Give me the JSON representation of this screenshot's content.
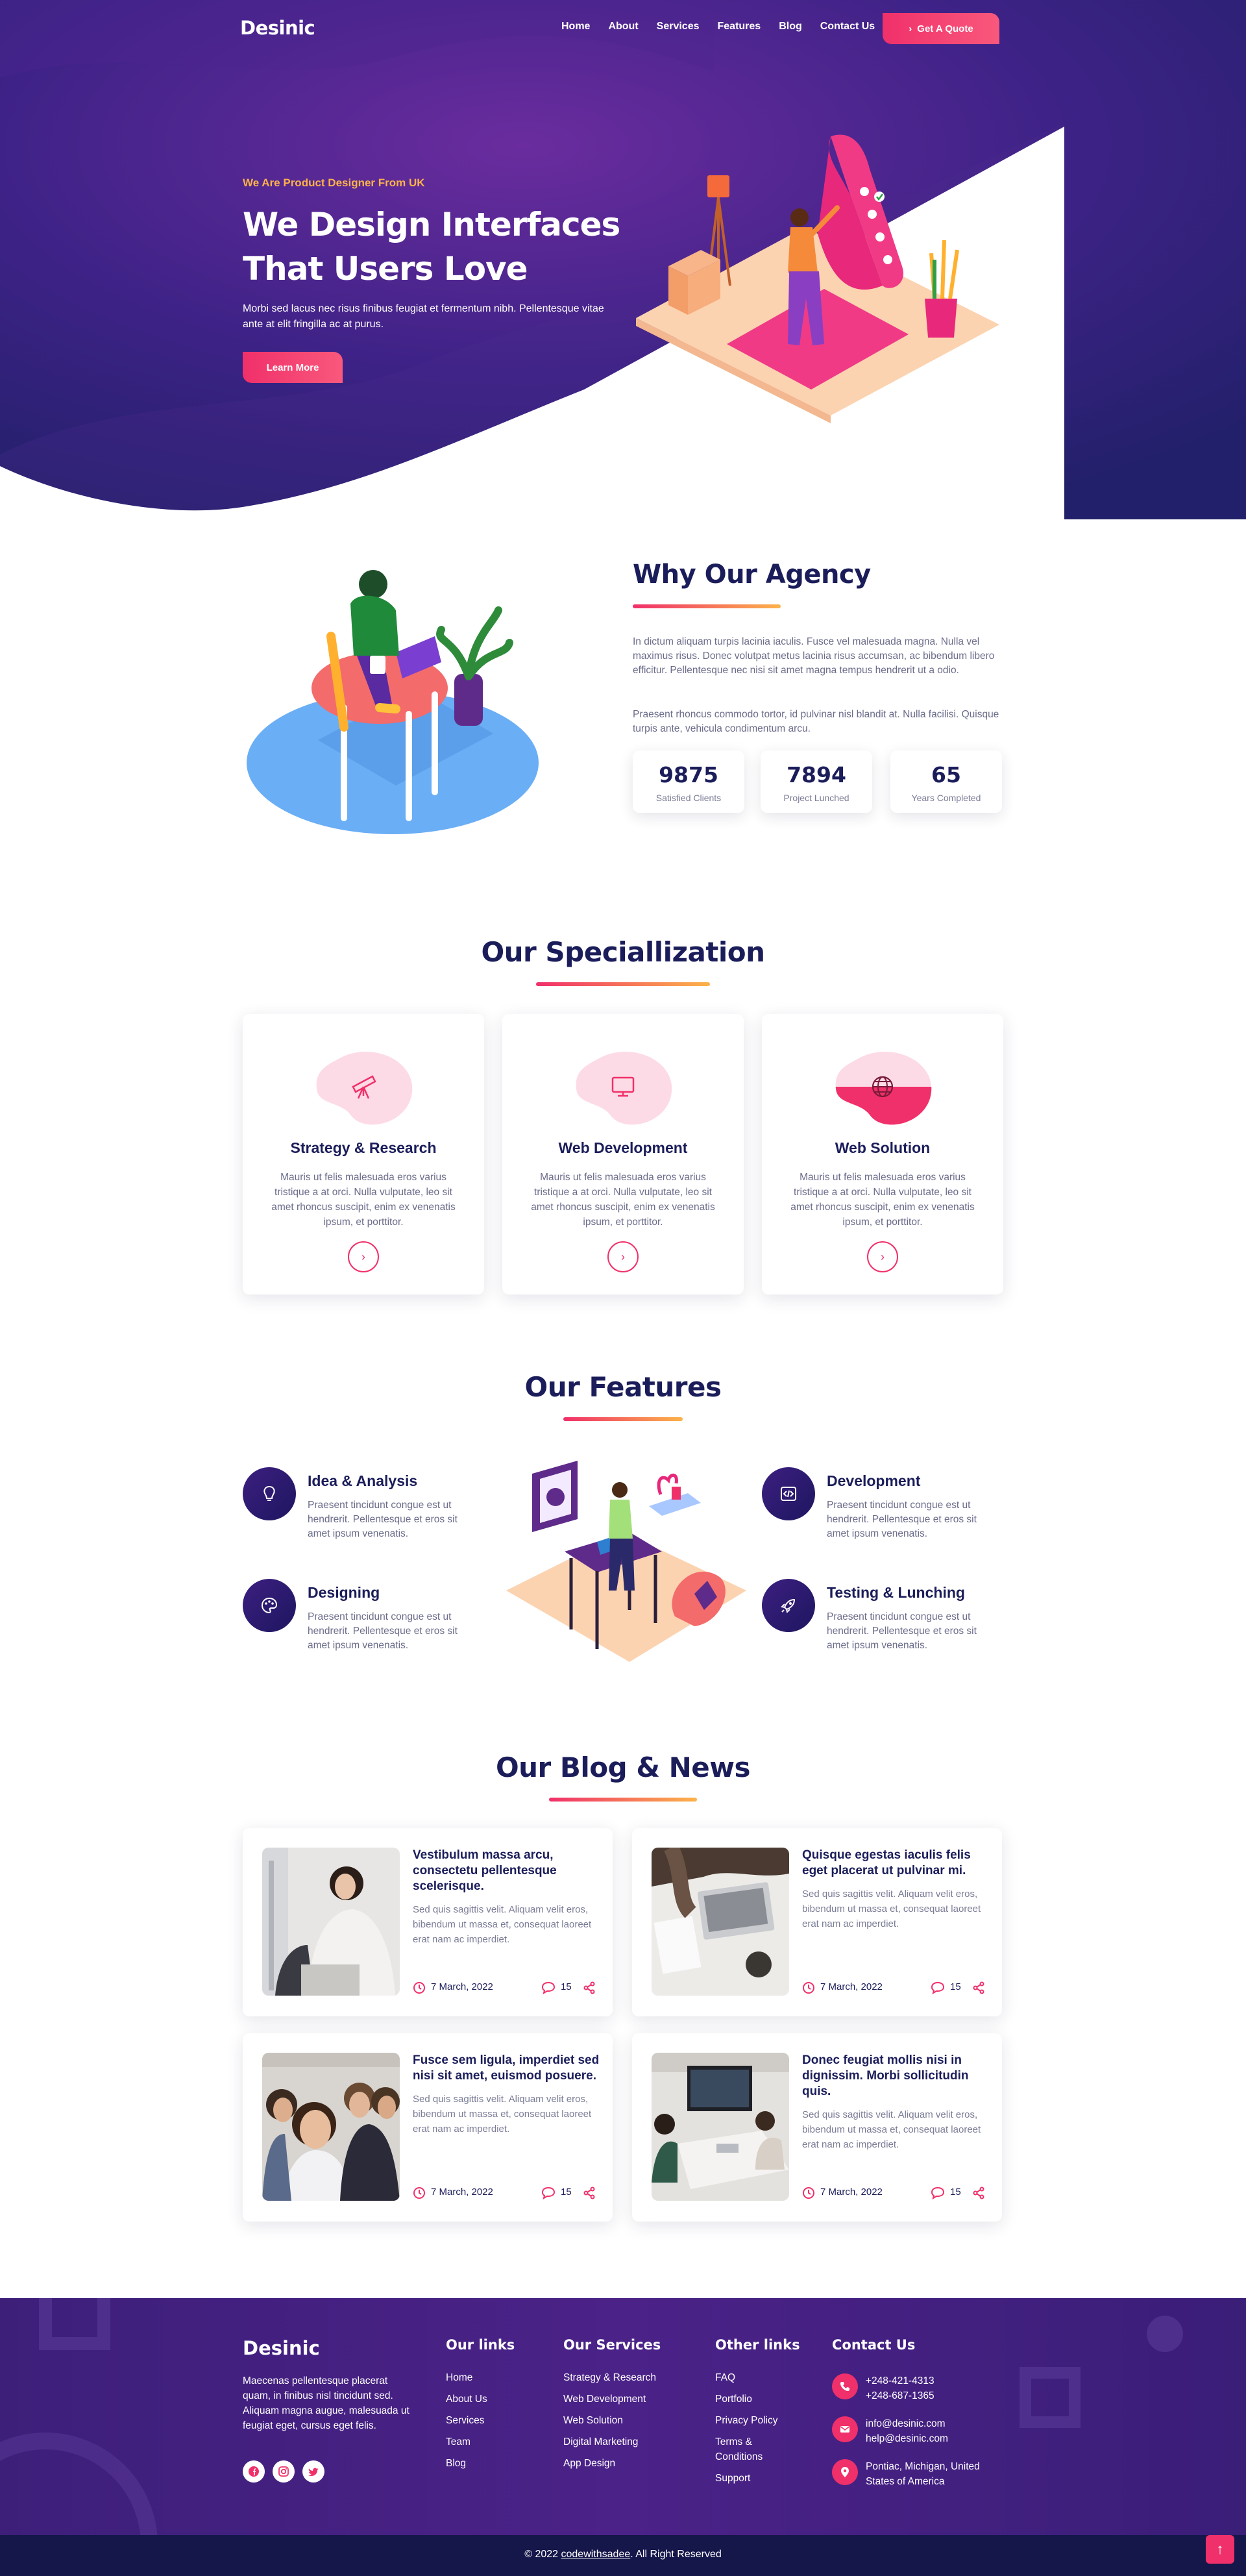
{
  "nav": {
    "brand": "Desinic",
    "links": [
      "Home",
      "About",
      "Services",
      "Features",
      "Blog",
      "Contact Us"
    ],
    "cta": "Get A Quote",
    "cta_icon": "chevron-right-icon"
  },
  "hero": {
    "eyebrow": "We Are Product Designer From UK",
    "title_line1": "We Design Interfaces",
    "title_line2": "That Users Love",
    "subtitle": "Morbi sed lacus nec risus finibus feugiat et fermentum nibh. Pellentesque vitae ante at elit fringilla ac at purus.",
    "button": "Learn More"
  },
  "agency": {
    "title": "Why Our Agency",
    "p1": "In dictum aliquam turpis lacinia iaculis. Fusce vel malesuada magna. Nulla vel maximus risus. Donec volutpat metus lacinia risus accumsan, ac bibendum libero efficitur. Pellentesque nec nisi sit amet magna tempus hendrerit ut a odio.",
    "p2": "Praesent rhoncus commodo tortor, id pulvinar nisl blandit at. Nulla facilisi. Quisque turpis ante, vehicula condimentum arcu.",
    "stats": [
      {
        "value": "9875",
        "label": "Satisfied Clients"
      },
      {
        "value": "7894",
        "label": "Project Lunched"
      },
      {
        "value": "65",
        "label": "Years Completed"
      }
    ]
  },
  "specialization": {
    "title": "Our Speciallization",
    "cards": [
      {
        "title": "Strategy & Research",
        "text": "Mauris ut felis malesuada eros varius tristique a at orci. Nulla vulputate, leo sit amet rhoncus suscipit, enim ex venenatis ipsum, et porttitor.",
        "icon": "telescope-icon"
      },
      {
        "title": "Web Development",
        "text": "Mauris ut felis malesuada eros varius tristique a at orci. Nulla vulputate, leo sit amet rhoncus suscipit, enim ex venenatis ipsum, et porttitor.",
        "icon": "monitor-icon"
      },
      {
        "title": "Web Solution",
        "text": "Mauris ut felis malesuada eros varius tristique a at orci. Nulla vulputate, leo sit amet rhoncus suscipit, enim ex venenatis ipsum, et porttitor.",
        "icon": "globe-icon"
      }
    ]
  },
  "features": {
    "title": "Our Features",
    "items": [
      {
        "title": "Idea & Analysis",
        "text": "Praesent tincidunt congue est ut hendrerit. Pellentesque et eros sit amet ipsum venenatis.",
        "icon": "lightbulb-icon"
      },
      {
        "title": "Designing",
        "text": "Praesent tincidunt congue est ut hendrerit. Pellentesque et eros sit amet ipsum venenatis.",
        "icon": "palette-icon"
      },
      {
        "title": "Development",
        "text": "Praesent tincidunt congue est ut hendrerit. Pellentesque et eros sit amet ipsum venenatis.",
        "icon": "code-icon"
      },
      {
        "title": "Testing & Lunching",
        "text": "Praesent tincidunt congue est ut hendrerit. Pellentesque et eros sit amet ipsum venenatis.",
        "icon": "rocket-icon"
      }
    ]
  },
  "blog": {
    "title": "Our Blog & News",
    "posts": [
      {
        "title": "Vestibulum massa arcu, consectetu pellentesque scelerisque.",
        "text": "Sed quis sagittis velit. Aliquam velit eros, bibendum ut massa et, consequat laoreet erat nam ac imperdiet.",
        "date": "7 March, 2022",
        "comments": "15"
      },
      {
        "title": "Quisque egestas iaculis felis eget placerat ut pulvinar mi.",
        "text": "Sed quis sagittis velit. Aliquam velit eros, bibendum ut massa et, consequat laoreet erat nam ac imperdiet.",
        "date": "7 March, 2022",
        "comments": "15"
      },
      {
        "title": "Fusce sem ligula, imperdiet sed nisi sit amet, euismod posuere.",
        "text": "Sed quis sagittis velit. Aliquam velit eros, bibendum ut massa et, consequat laoreet erat nam ac imperdiet.",
        "date": "7 March, 2022",
        "comments": "15"
      },
      {
        "title": "Donec feugiat mollis nisi in dignissim. Morbi sollicitudin quis.",
        "text": "Sed quis sagittis velit. Aliquam velit eros, bibendum ut massa et, consequat laoreet erat nam ac imperdiet.",
        "date": "7 March, 2022",
        "comments": "15"
      }
    ]
  },
  "footer": {
    "brand": "Desinic",
    "about": "Maecenas pellentesque placerat quam, in finibus nisl tincidunt sed. Aliquam magna augue, malesuada ut feugiat eget, cursus eget felis.",
    "social": [
      "facebook-icon",
      "instagram-icon",
      "twitter-icon"
    ],
    "links_title": "Our links",
    "links": [
      "Home",
      "About Us",
      "Services",
      "Team",
      "Blog"
    ],
    "services_title": "Our Services",
    "services": [
      "Strategy & Research",
      "Web Development",
      "Web Solution",
      "Digital Marketing",
      "App Design"
    ],
    "other_title": "Other links",
    "other": [
      "FAQ",
      "Portfolio",
      "Privacy Policy",
      "Terms &",
      "Conditions",
      "Support"
    ],
    "contact_title": "Contact Us",
    "phone1": "+248-421-4313",
    "phone2": "+248-687-1365",
    "email1": "info@desinic.com",
    "email2": "help@desinic.com",
    "address": "Pontiac, Michigan, United States of America",
    "copyright_pre": "© 2022 ",
    "copyright_link": "codewithsadee",
    "copyright_post": ". All Right Reserved"
  },
  "colors": {
    "primary": "#1b1d5a",
    "accent": "#f0306a",
    "purple": "#5b2a96",
    "orange": "#fcb24a"
  }
}
